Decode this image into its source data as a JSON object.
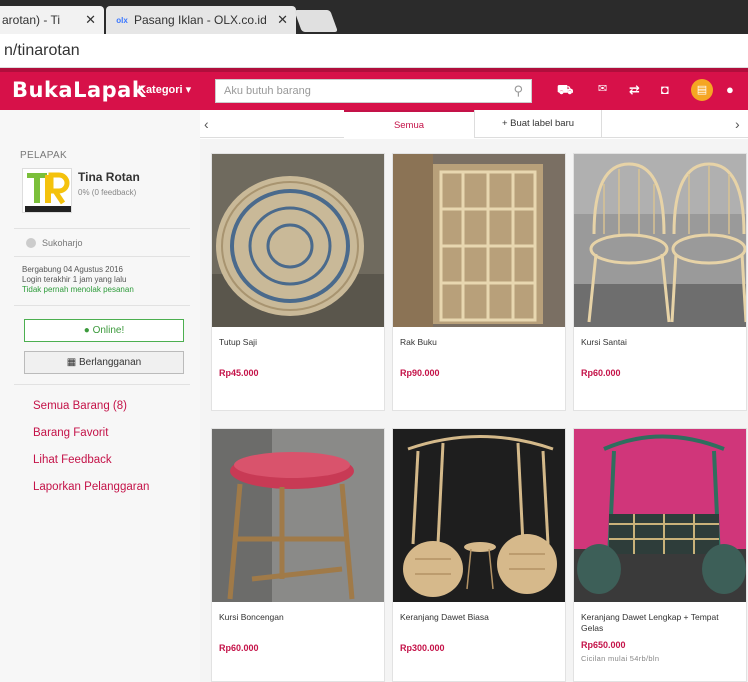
{
  "browser": {
    "tabs": [
      {
        "label": "arotan) - Ti",
        "close": "✕"
      },
      {
        "label": "Pasang Iklan - OLX.co.id",
        "close": "✕",
        "icon": "olx-icon"
      }
    ],
    "url": "n/tinarotan"
  },
  "header": {
    "logo": "BukaLapak",
    "kategori": "Kategori ▾",
    "search_placeholder": "Aku butuh barang",
    "brand_color": "#d71149"
  },
  "sidebar": {
    "section_label": "PELAPAK",
    "store_name": "Tina Rotan",
    "feedback": "0% (0 feedback)",
    "location": "Sukoharjo",
    "joined": "Bergabung 04 Agustus 2016",
    "last_login": "Login terakhir 1 jam yang lalu",
    "never_reject": "Tidak pernah menolak pesanan",
    "online_label": "Online!",
    "subscribe_label": "Berlangganan",
    "links": [
      "Semua Barang (8)",
      "Barang Favorit",
      "Lihat Feedback",
      "Laporkan Pelanggaran"
    ]
  },
  "tabs": {
    "left_arrow": "‹",
    "right_arrow": "›",
    "active": "Semua",
    "new_label": "+ Buat label baru"
  },
  "products": [
    {
      "name": "Tutup Saji",
      "price": "Rp45.000"
    },
    {
      "name": "Rak Buku",
      "price": "Rp90.000"
    },
    {
      "name": "Kursi Santai",
      "price": "Rp60.000"
    },
    {
      "name": "Kursi Boncengan",
      "price": "Rp60.000"
    },
    {
      "name": "Keranjang Dawet Biasa",
      "price": "Rp300.000"
    },
    {
      "name": "Keranjang Dawet Lengkap + Tempat Gelas",
      "price": "Rp650.000",
      "cicilan": "Cicilan mulai 54rb/bln"
    }
  ]
}
